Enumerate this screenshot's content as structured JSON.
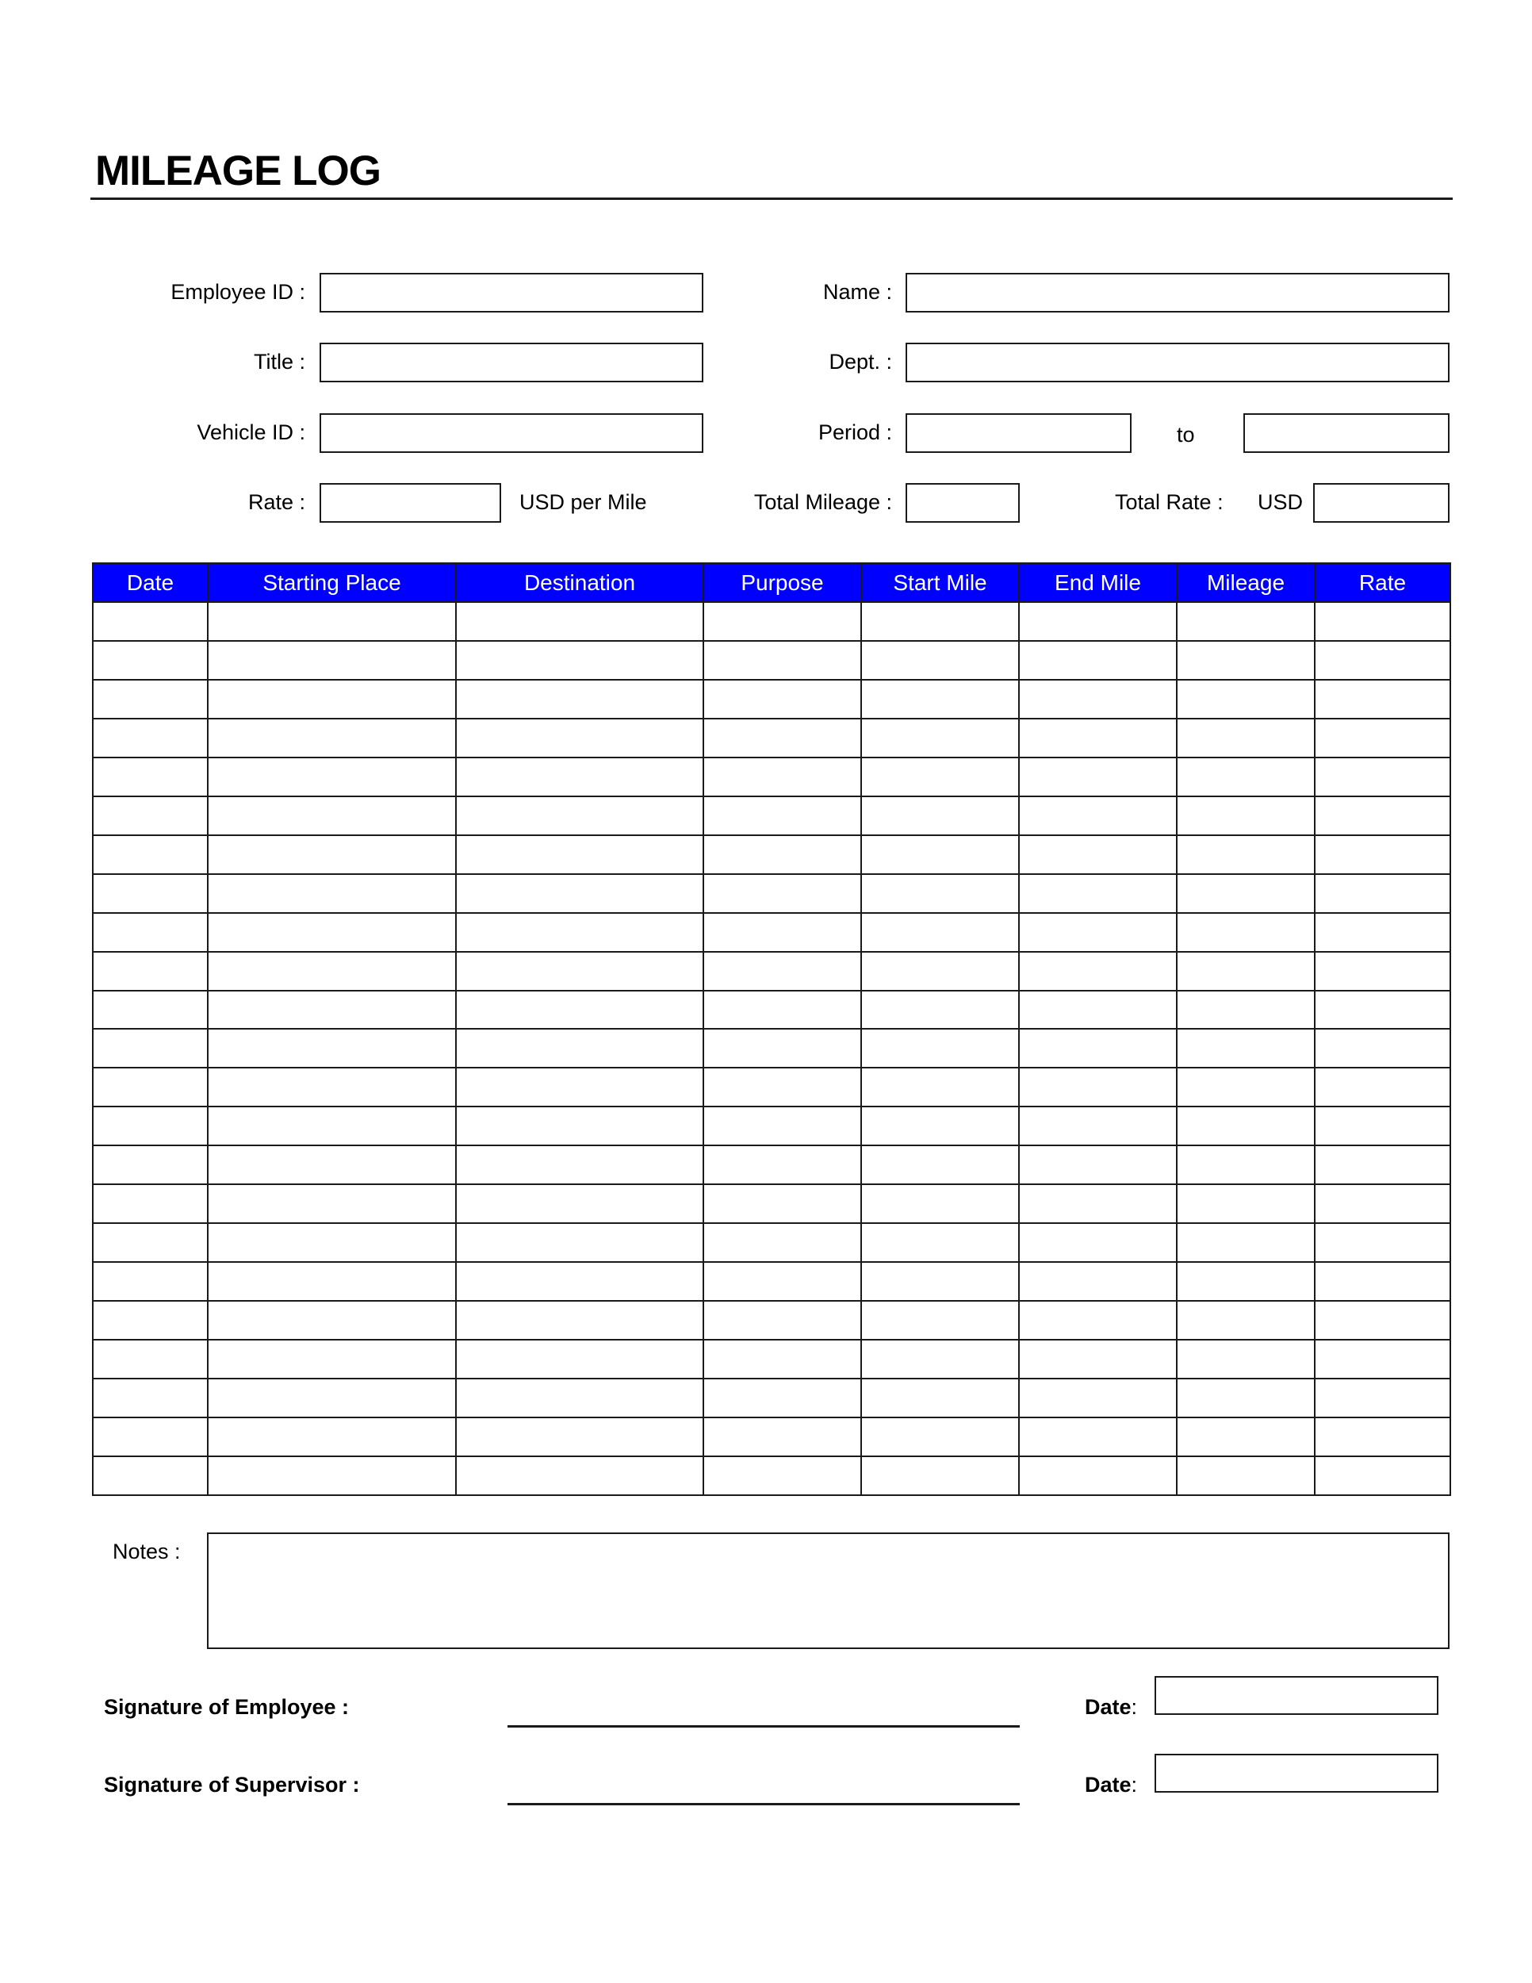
{
  "header": {
    "title": "MILEAGE LOG"
  },
  "form": {
    "employee_id": {
      "label": "Employee ID :",
      "value": ""
    },
    "name": {
      "label": "Name :",
      "value": ""
    },
    "title": {
      "label": "Title :",
      "value": ""
    },
    "dept": {
      "label": "Dept. :",
      "value": ""
    },
    "vehicle_id": {
      "label": "Vehicle ID :",
      "value": ""
    },
    "period": {
      "label": "Period :",
      "from_value": "",
      "to_label": "to",
      "to_value": ""
    },
    "rate": {
      "label": "Rate :",
      "value": "",
      "unit": "USD per Mile"
    },
    "total_mileage": {
      "label": "Total Mileage :",
      "value": ""
    },
    "total_rate": {
      "label": "Total Rate :",
      "currency": "USD",
      "value": ""
    }
  },
  "table": {
    "header_color": "#0000FF",
    "columns": [
      "Date",
      "Starting Place",
      "Destination",
      "Purpose",
      "Start Mile",
      "End Mile",
      "Mileage",
      "Rate"
    ],
    "row_count": 23,
    "rows": []
  },
  "notes": {
    "label": "Notes :",
    "value": ""
  },
  "signatures": {
    "employee": {
      "label": "Signature of Employee :",
      "date_label": "Date",
      "date_colon": ":",
      "date_value": ""
    },
    "supervisor": {
      "label": "Signature of Supervisor :",
      "date_label": "Date",
      "date_colon": ":",
      "date_value": ""
    }
  }
}
